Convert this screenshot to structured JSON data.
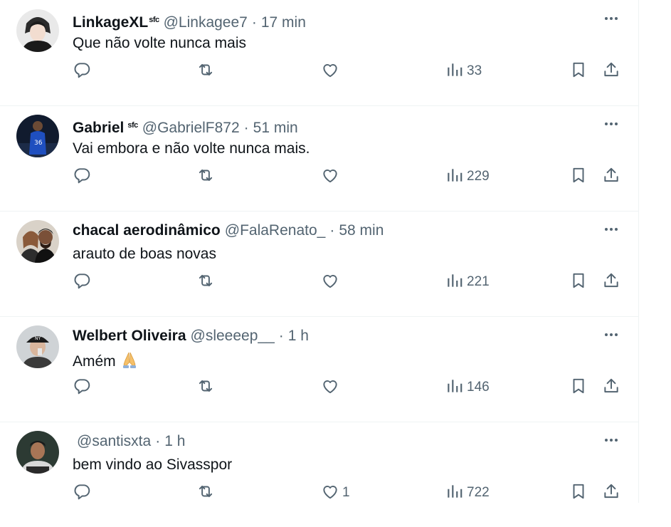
{
  "tweets": [
    {
      "name": "LinkageXL",
      "badge": "sfc",
      "handle": "@Linkagee7",
      "separator": "·",
      "time": "17 min",
      "text": "Que não volte nunca mais",
      "views": "33",
      "likes": "",
      "avatar": "avatar-anime-character"
    },
    {
      "name": "Gabriel",
      "badge": "sfc",
      "handle": "@GabrielF872",
      "separator": "·",
      "time": "51 min",
      "text": "Vai embora e não volte nunca mais.",
      "views": "229",
      "likes": "",
      "avatar": "avatar-football-player-36"
    },
    {
      "name": "chacal aerodinâmico",
      "badge": "",
      "handle": "@FalaRenato_",
      "separator": "·",
      "time": "58 min",
      "text": "arauto de boas novas",
      "views": "221",
      "likes": "",
      "avatar": "avatar-two-people"
    },
    {
      "name": "Welbert Oliveira",
      "badge": "",
      "handle": "@sleeeep__",
      "separator": "·",
      "time": "1 h",
      "text": "Amém",
      "emoji": "folded-hands-emoji",
      "views": "146",
      "likes": "",
      "avatar": "avatar-man-cap"
    },
    {
      "name": "",
      "badge": "",
      "handle": "@santisxta",
      "separator": "·",
      "time": "1 h",
      "text": "bem vindo ao Sivasspor",
      "views": "722",
      "likes": "1",
      "avatar": "avatar-football-player"
    }
  ],
  "colors": {
    "text": "#0f1419",
    "secondary": "#536471",
    "divider": "#eff3f4"
  },
  "icons": [
    "reply-icon",
    "retweet-icon",
    "like-icon",
    "views-icon",
    "bookmark-icon",
    "share-icon",
    "more-icon"
  ]
}
